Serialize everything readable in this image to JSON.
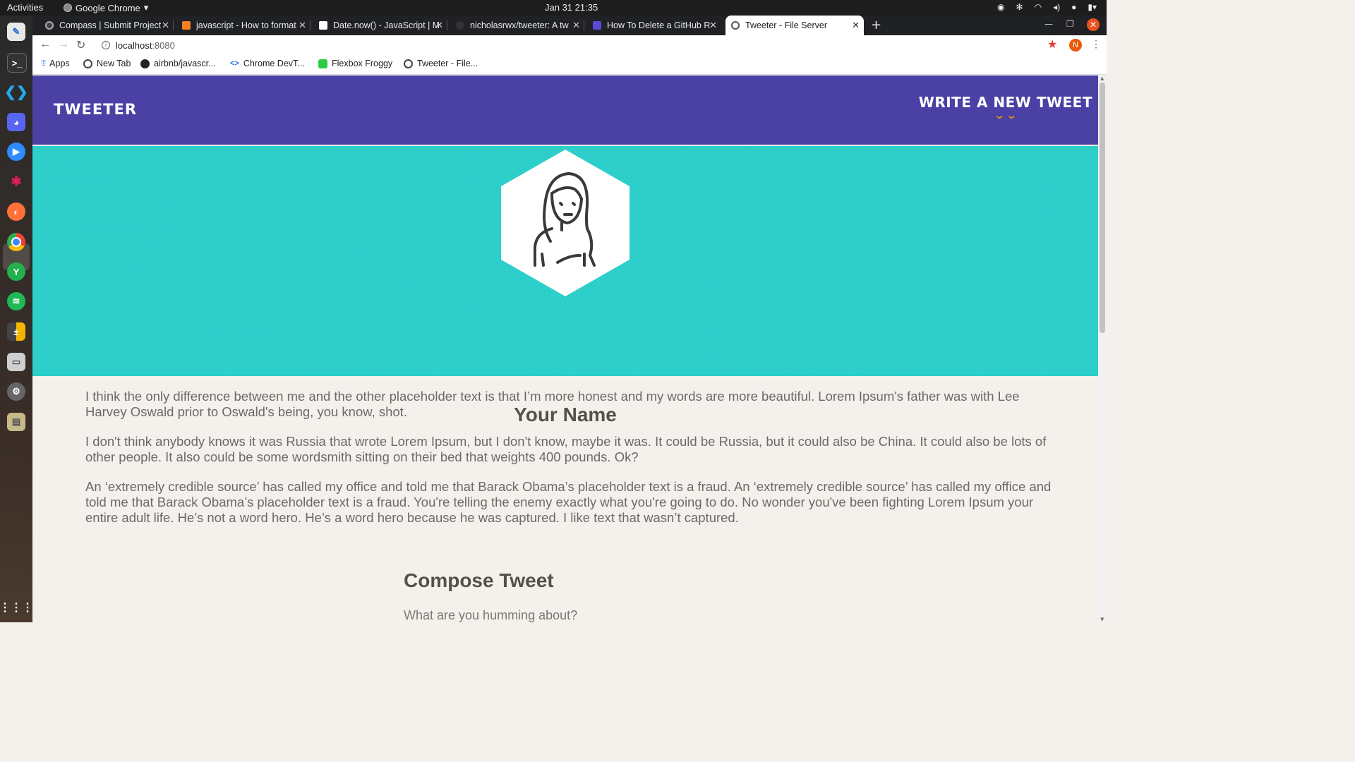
{
  "os": {
    "activities": "Activities",
    "app_name": "Google Chrome",
    "clock": "Jan 31  21:35"
  },
  "browser": {
    "tabs": [
      {
        "title": "Compass | Submit Project",
        "icon": "compass-favicon",
        "color": "#444"
      },
      {
        "title": "javascript - How to format",
        "icon": "stackoverflow-favicon",
        "color": "#f48024"
      },
      {
        "title": "Date.now() - JavaScript | M",
        "icon": "mdn-favicon",
        "color": "#000"
      },
      {
        "title": "nicholasrwx/tweeter: A tw",
        "icon": "github-favicon",
        "color": "#333"
      },
      {
        "title": "How To Delete a GitHub R",
        "icon": "howto-favicon",
        "color": "#5b4bd6"
      },
      {
        "title": "Tweeter - File Server",
        "icon": "globe-favicon",
        "color": "#555"
      }
    ],
    "active_tab": 5,
    "url_host": "localhost",
    "url_port": ":8080",
    "profile_initial": "N",
    "bookmarks": [
      {
        "label": "Apps",
        "icon": "apps-grid-icon"
      },
      {
        "label": "New Tab",
        "icon": "globe-icon"
      },
      {
        "label": "airbnb/javascr...",
        "icon": "github-icon"
      },
      {
        "label": "Chrome DevT...",
        "icon": "devtools-icon"
      },
      {
        "label": "Flexbox Froggy",
        "icon": "frog-icon"
      },
      {
        "label": "Tweeter - File...",
        "icon": "globe-icon"
      }
    ]
  },
  "site": {
    "brand": "Tweeter",
    "compose_toggle": "Write a new tweet",
    "compose_chevron": "»",
    "user_name": "Your Name",
    "bio": [
      "I think the only difference between me and the other placeholder text is that I’m more honest and my words are more beautiful. Lorem Ipsum's father was with Lee Harvey Oswald prior to Oswald's being, you know, shot.",
      "I don't think anybody knows it was Russia that wrote Lorem Ipsum, but I don't know, maybe it was. It could be Russia, but it could also be China. It could also be lots of other people. It also could be some wordsmith sitting on their bed that weights 400 pounds. Ok?",
      "An ‘extremely credible source’ has called my office and told me that Barack Obama’s placeholder text is a fraud. An ‘extremely credible source’ has called my office and told me that Barack Obama’s placeholder text is a fraud. You're telling the enemy exactly what you're going to do. No wonder you've been fighting Lorem Ipsum your entire adult life. He’s not a word hero. He’s a word hero because he was captured. I like text that wasn’t captured."
    ],
    "compose_title": "Compose Tweet",
    "compose_placeholder": "What are you humming about?",
    "colors": {
      "nav": "#4b41a5",
      "header": "#2ad0cb",
      "background": "#f4f1ec",
      "accent": "#e6a000"
    }
  }
}
